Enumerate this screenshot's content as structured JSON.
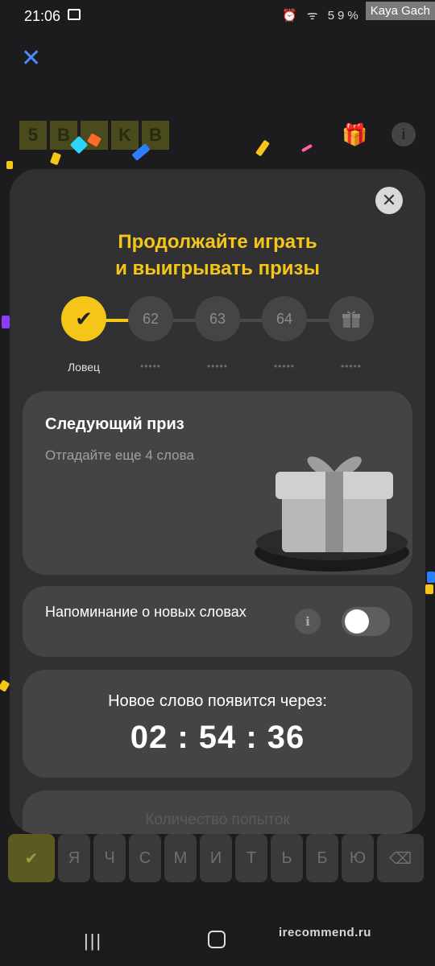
{
  "status_bar": {
    "time": "21:06",
    "icons": "⏰ ᯤ ",
    "battery": "59%",
    "author_watermark": "Kaya Gach"
  },
  "game_background": {
    "tiles": [
      "5",
      "B",
      "",
      "K",
      "B"
    ]
  },
  "modal": {
    "title_line1": "Продолжайте играть",
    "title_line2": "и выигрывать призы",
    "close_label": "✕",
    "progress": {
      "steps": [
        {
          "label": "✔",
          "caption": "Ловец",
          "done": true
        },
        {
          "label": "62",
          "caption": "•••••",
          "done": false
        },
        {
          "label": "63",
          "caption": "•••••",
          "done": false
        },
        {
          "label": "64",
          "caption": "•••••",
          "done": false
        },
        {
          "label": "gift-icon",
          "caption": "•••••",
          "done": false
        }
      ]
    },
    "next_prize": {
      "title": "Следующий приз",
      "subtitle": "Отгадайте еще 4 слова"
    },
    "reminder": {
      "text": "Напоминание о новых словах",
      "info_label": "i",
      "enabled": false
    },
    "timer": {
      "label": "Новое слово появится через:",
      "hours": "02",
      "minutes": "54",
      "seconds": "36"
    },
    "attempts": {
      "text": "Количество попыток"
    }
  },
  "keyboard": {
    "keys": [
      "Я",
      "Ч",
      "С",
      "М",
      "И",
      "Т",
      "Ь",
      "Б",
      "Ю"
    ]
  },
  "site_watermark": "irecommend.ru",
  "colors": {
    "accent": "#f5c518",
    "modal_bg": "#313133",
    "card_bg": "#444446",
    "close_x": "#4a8cff"
  }
}
